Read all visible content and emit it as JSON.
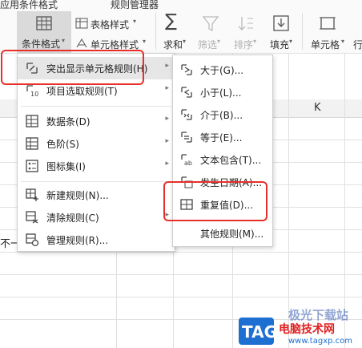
{
  "ribbon": {
    "top_left_text": "应用条件格式",
    "top_mid_text": "规则管理器",
    "cond_format_label": "条件格式",
    "table_style_label": "表格样式",
    "cell_style_label": "单元格样式",
    "sum_label": "求和",
    "filter_label": "筛选",
    "sort_label": "排序",
    "fill_label": "填充",
    "cell_label": "单元格",
    "row_label": "行"
  },
  "sheet": {
    "col_k_header": "K",
    "left_cell_text": "不一"
  },
  "menu_main": {
    "items": [
      {
        "label": "突出显示单元格规则(H)",
        "icon": "highlight-rules-icon",
        "submenu": true
      },
      {
        "label": "项目选取规则(T)",
        "icon": "top-bottom-rules-icon",
        "submenu": true
      },
      {
        "label": "数据条(D)",
        "icon": "data-bars-icon",
        "submenu": true
      },
      {
        "label": "色阶(S)",
        "icon": "color-scales-icon",
        "submenu": true
      },
      {
        "label": "图标集(I)",
        "icon": "icon-sets-icon",
        "submenu": true
      },
      {
        "label": "新建规则(N)...",
        "icon": "new-rule-icon",
        "submenu": false
      },
      {
        "label": "清除规则(C)",
        "icon": "clear-rules-icon",
        "submenu": true
      },
      {
        "label": "管理规则(R)...",
        "icon": "manage-rules-icon",
        "submenu": false
      }
    ]
  },
  "menu_sub": {
    "items": [
      {
        "label": "大于(G)...",
        "icon": "greater-than-icon"
      },
      {
        "label": "小于(L)...",
        "icon": "less-than-icon"
      },
      {
        "label": "介于(B)...",
        "icon": "between-icon"
      },
      {
        "label": "等于(E)...",
        "icon": "equal-to-icon"
      },
      {
        "label": "文本包含(T)...",
        "icon": "text-contains-icon"
      },
      {
        "label": "发生日期(A)...",
        "icon": "date-occurring-icon"
      },
      {
        "label": "重复值(D)...",
        "icon": "duplicate-values-icon"
      },
      {
        "label": "其他规则(M)...",
        "icon": ""
      }
    ]
  },
  "watermark": {
    "logo": "TAG",
    "line1": "极光下载站",
    "line2": "电脑技术网",
    "url": "www.tagxp.com"
  },
  "colors": {
    "highlight_box": "#e8302a",
    "menu_hover": "#e6e6e6",
    "watermark_blue": "#1d6fd1",
    "watermark_red": "#e02020"
  }
}
